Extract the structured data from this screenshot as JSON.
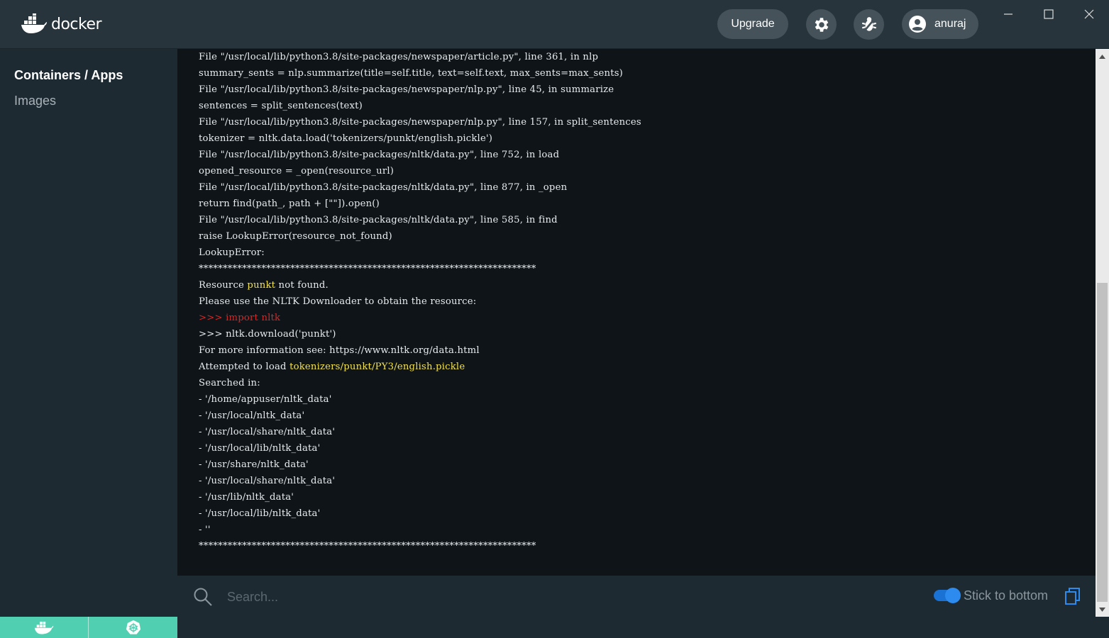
{
  "app": {
    "logo_text": "docker"
  },
  "header": {
    "upgrade_label": "Upgrade",
    "settings_icon": "gear-icon",
    "bug_icon": "bug-icon",
    "user_name": "anuraj"
  },
  "sidebar": {
    "items": [
      {
        "label": "Containers / Apps",
        "active": true
      },
      {
        "label": "Images",
        "active": false
      }
    ],
    "bottom_icons": [
      "docker-whale-icon",
      "kubernetes-icon"
    ]
  },
  "log": {
    "lines": [
      "File \"/usr/local/lib/python3.8/site-packages/newspaper/article.py\", line 361, in nlp",
      "summary_sents = nlp.summarize(title=self.title, text=self.text, max_sents=max_sents)",
      "File \"/usr/local/lib/python3.8/site-packages/newspaper/nlp.py\", line 45, in summarize",
      "sentences = split_sentences(text)",
      "File \"/usr/local/lib/python3.8/site-packages/newspaper/nlp.py\", line 157, in split_sentences",
      "tokenizer = nltk.data.load('tokenizers/punkt/english.pickle')",
      "File \"/usr/local/lib/python3.8/site-packages/nltk/data.py\", line 752, in load",
      "opened_resource = _open(resource_url)",
      "File \"/usr/local/lib/python3.8/site-packages/nltk/data.py\", line 877, in _open",
      "return find(path_, path + [\"\"]).open()",
      "File \"/usr/local/lib/python3.8/site-packages/nltk/data.py\", line 585, in find",
      "raise LookupError(resource_not_found)",
      "LookupError:",
      "**********************************************************************",
      "Resource ",
      "Please use the NLTK Downloader to obtain the resource:",
      ">>> import nltk",
      ">>> nltk.download('punkt')",
      "For more information see: https://www.nltk.org/data.html",
      "Attempted to load ",
      "Searched in:",
      "- '/home/appuser/nltk_data'",
      "- '/usr/local/nltk_data'",
      "- '/usr/local/share/nltk_data'",
      "- '/usr/local/lib/nltk_data'",
      "- '/usr/share/nltk_data'",
      "- '/usr/local/share/nltk_data'",
      "- '/usr/lib/nltk_data'",
      "- '/usr/local/lib/nltk_data'",
      "- ''",
      "**********************************************************************"
    ],
    "resource_name": "punkt",
    "resource_suffix": " not found.",
    "attempted_path": "tokenizers/punkt/PY3/english.pickle"
  },
  "search": {
    "placeholder": "Search...",
    "value": "",
    "stick_label": "Stick to bottom",
    "stick_enabled": true
  },
  "colors": {
    "highlight": "#f4e24a",
    "error": "#d72626",
    "accent": "#2d8bf0",
    "footer": "#50d0b0"
  }
}
